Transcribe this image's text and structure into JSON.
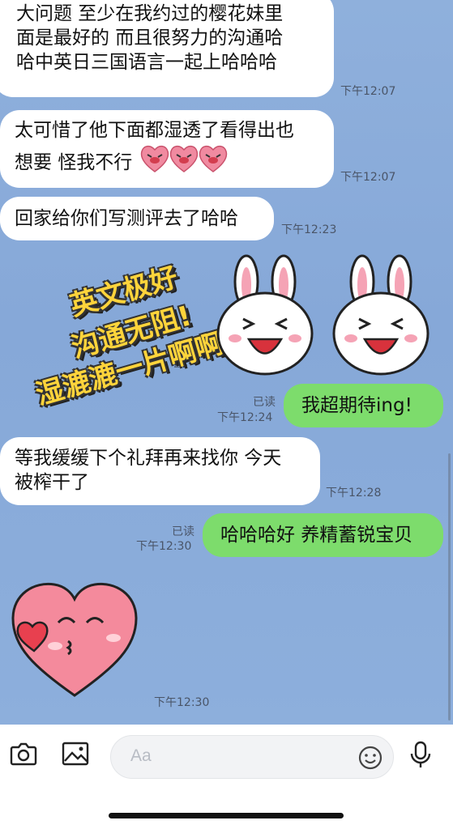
{
  "messages": {
    "m1": {
      "text_l1": "大问题 至少在我约过的樱花妹里",
      "text_l2": "面是最好的 而且很努力的沟通哈",
      "text_l3": "哈中英日三国语言一起上哈哈哈",
      "time": "下午12:07"
    },
    "m2": {
      "text_l1": "太可惜了他下面都湿透了看得出也",
      "text_l2": "想要 怪我不行",
      "time": "下午12:07",
      "emoji": "crying-heart-emoji"
    },
    "m3": {
      "text": "回家给你们写测评去了哈哈",
      "time": "下午12:23"
    },
    "sticker1": {
      "line1": "英文极好",
      "line2": "沟通无阻!",
      "line3": "湿漉漉一片啊啊啊",
      "time_partial": "24"
    },
    "m4": {
      "text": "我超期待ing!",
      "read": "已读",
      "time": "下午12:24"
    },
    "m5": {
      "text_l1": "等我缓缓下个礼拜再来找你 今天",
      "text_l2": "被榨干了",
      "time": "下午12:28"
    },
    "m6": {
      "text": "哈哈哈好 养精蓄锐宝贝",
      "read": "已读",
      "time": "下午12:30"
    },
    "sticker2": {
      "time": "下午12:30",
      "icon": "kissing-heart-sticker"
    }
  },
  "toolbar": {
    "camera_icon": "camera-icon",
    "image_icon": "image-icon",
    "input_placeholder": "Aa",
    "emoji_icon": "smiley-icon",
    "mic_icon": "microphone-icon"
  },
  "colors": {
    "chat_bg": "#8aaddb",
    "incoming": "#ffffff",
    "outgoing": "#7ddc6c"
  }
}
